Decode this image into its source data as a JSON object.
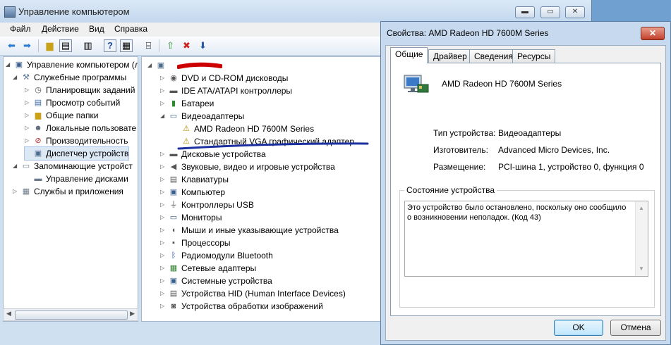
{
  "main_window": {
    "title": "Управление компьютером",
    "controls": {
      "minimize": "▬",
      "maximize": "▭",
      "close": "✕"
    }
  },
  "menu": {
    "items": [
      "Файл",
      "Действие",
      "Вид",
      "Справка"
    ]
  },
  "toolbar": {
    "buttons": [
      "back-icon",
      "forward-icon",
      "up-folder-icon",
      "show-hide-tree-icon",
      "properties-icon",
      "help-icon",
      "view-icon",
      "scan-hardware-icon",
      "update-driver-icon",
      "disable-device-icon",
      "uninstall-device-icon"
    ]
  },
  "tree": {
    "items": [
      {
        "label": "Управление компьютером (л",
        "level": 0,
        "icon": "computer-management-icon"
      },
      {
        "label": "Служебные программы",
        "level": 1,
        "icon": "tools-icon"
      },
      {
        "label": "Планировщик заданий",
        "level": 2,
        "icon": "clock-icon"
      },
      {
        "label": "Просмотр событий",
        "level": 2,
        "icon": "event-viewer-icon"
      },
      {
        "label": "Общие папки",
        "level": 2,
        "icon": "shared-folder-icon"
      },
      {
        "label": "Локальные пользовате",
        "level": 2,
        "icon": "users-icon"
      },
      {
        "label": "Производительность",
        "level": 2,
        "icon": "performance-icon"
      },
      {
        "label": "Диспетчер устройств",
        "level": 2,
        "icon": "device-manager-icon",
        "selected": true
      },
      {
        "label": "Запоминающие устройст",
        "level": 1,
        "icon": "storage-icon"
      },
      {
        "label": "Управление дисками",
        "level": 2,
        "icon": "disk-icon"
      },
      {
        "label": "Службы и приложения",
        "level": 1,
        "icon": "services-icon"
      }
    ]
  },
  "devices": {
    "root_label": "",
    "categories": [
      {
        "label": "DVD и CD-ROM дисководы",
        "icon": "dvd-icon"
      },
      {
        "label": "IDE ATA/ATAPI контроллеры",
        "icon": "ide-icon"
      },
      {
        "label": "Батареи",
        "icon": "battery-icon"
      },
      {
        "label": "Видеоадаптеры",
        "icon": "display-adapter-icon",
        "expanded": true,
        "children": [
          {
            "label": "AMD Radeon HD 7600M Series",
            "icon": "warning-display-icon"
          },
          {
            "label": "Стандартный VGA графический адаптер",
            "icon": "warning-display-icon"
          }
        ]
      },
      {
        "label": "Дисковые устройства",
        "icon": "drive-icon"
      },
      {
        "label": "Звуковые, видео и игровые устройства",
        "icon": "speaker-icon"
      },
      {
        "label": "Клавиатуры",
        "icon": "keyboard-icon"
      },
      {
        "label": "Компьютер",
        "icon": "computer-icon"
      },
      {
        "label": "Контроллеры USB",
        "icon": "usb-icon"
      },
      {
        "label": "Мониторы",
        "icon": "monitor-icon"
      },
      {
        "label": "Мыши и иные указывающие устройства",
        "icon": "mouse-icon"
      },
      {
        "label": "Процессоры",
        "icon": "processor-icon"
      },
      {
        "label": "Радиомодули Bluetooth",
        "icon": "bluetooth-icon"
      },
      {
        "label": "Сетевые адаптеры",
        "icon": "network-icon"
      },
      {
        "label": "Системные устройства",
        "icon": "system-icon"
      },
      {
        "label": "Устройства HID (Human Interface Devices)",
        "icon": "hid-icon"
      },
      {
        "label": "Устройства обработки изображений",
        "icon": "camera-icon"
      }
    ]
  },
  "dialog": {
    "title": "Свойства: AMD Radeon HD 7600M Series",
    "close": "✕",
    "tabs": [
      "Общие",
      "Драйвер",
      "Сведения",
      "Ресурсы"
    ],
    "device_name": "AMD Radeon HD 7600M Series",
    "properties": [
      {
        "label": "Тип устройства:",
        "value": "Видеоадаптеры"
      },
      {
        "label": "Изготовитель:",
        "value": "Advanced Micro Devices, Inc."
      },
      {
        "label": "Размещение:",
        "value": "PCI-шина 1, устройство 0, функция 0"
      }
    ],
    "status_group_label": "Состояние устройства",
    "status_text": "Это устройство было остановлено, поскольку оно сообщило о возникновении неполадок. (Код 43)",
    "ok_label": "OK",
    "cancel_label": "Отмена"
  },
  "colors": {
    "annotation_red": "#cc0000",
    "annotation_blue": "#1a2fa0",
    "warning_yellow": "#f2c200"
  }
}
